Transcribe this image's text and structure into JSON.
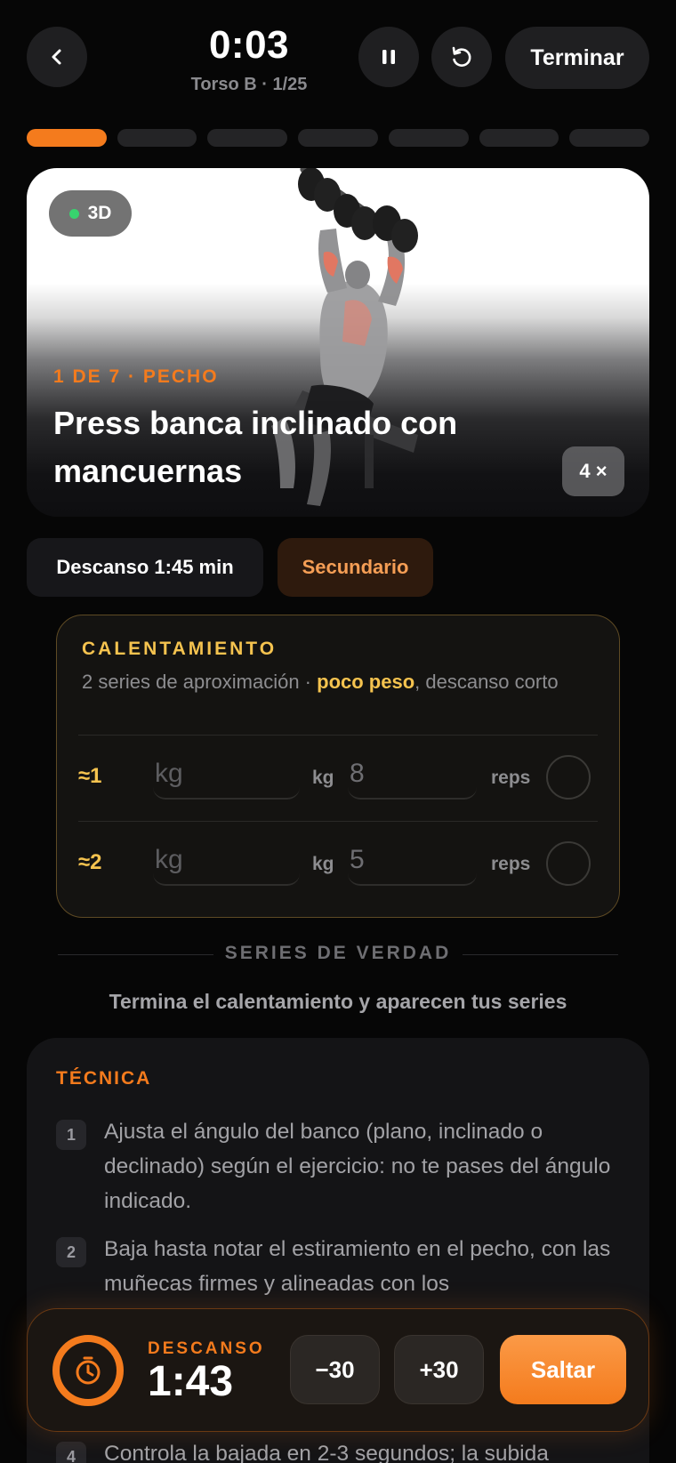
{
  "header": {
    "timer": "0:03",
    "subtitle": "Torso B · 1/25",
    "finish_label": "Terminar",
    "icons": [
      "chevron-left-icon",
      "pause-icon",
      "restart-icon"
    ]
  },
  "progress": {
    "total_segments": 7,
    "active_index": 0,
    "colors": {
      "active": "#f47b1d",
      "inactive": "#242426"
    }
  },
  "exercise": {
    "badge_3d": "3D",
    "kicker": "1 DE 7 · PECHO",
    "title": "Press banca inclinado con mancuernas",
    "sets_badge": "4 ×"
  },
  "tags": {
    "rest": "Descanso 1:45 min",
    "role": "Secundario"
  },
  "warmup": {
    "title": "CALENTAMIENTO",
    "desc_prefix": "2 series de aproximación · ",
    "desc_highlight": "poco peso",
    "desc_suffix": ", descanso corto",
    "rows": [
      {
        "label": "≈1",
        "kg_placeholder": "kg",
        "kg_unit": "kg",
        "reps_value": "8",
        "reps_unit": "reps"
      },
      {
        "label": "≈2",
        "kg_placeholder": "kg",
        "kg_unit": "kg",
        "reps_value": "5",
        "reps_unit": "reps"
      }
    ]
  },
  "real_sets": {
    "title": "SERIES DE VERDAD",
    "hint": "Termina el calentamiento y aparecen tus series"
  },
  "technique": {
    "title": "TÉCNICA",
    "steps": [
      {
        "num": "1",
        "text": "Ajusta el ángulo del banco (plano, inclinado o declinado) según el ejercicio: no te pases del ángulo indicado."
      },
      {
        "num": "2",
        "text": "Baja hasta notar el estiramiento en el pecho, con las muñecas firmes y alineadas con los"
      },
      {
        "num": "4",
        "text": "Controla la bajada en 2-3 segundos; la subida"
      }
    ]
  },
  "rest_timer": {
    "label": "DESCANSO",
    "time": "1:43",
    "minus_label": "−30",
    "plus_label": "+30",
    "skip_label": "Saltar",
    "accent": "#f47b1d"
  }
}
